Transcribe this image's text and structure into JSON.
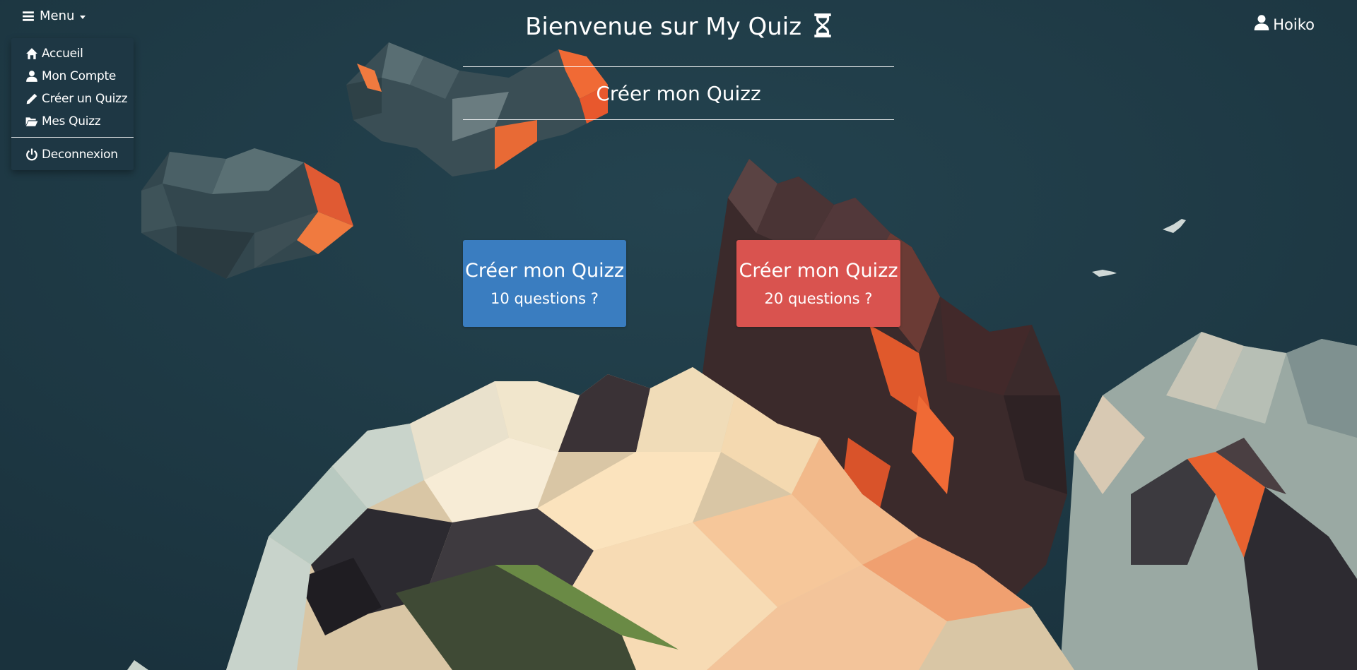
{
  "menu": {
    "toggle_label": "Menu",
    "items": [
      {
        "label": "Accueil",
        "icon": "home-icon"
      },
      {
        "label": "Mon Compte",
        "icon": "user-icon"
      },
      {
        "label": "Créer un Quizz",
        "icon": "pencil-icon"
      },
      {
        "label": "Mes Quizz",
        "icon": "folder-open-icon"
      }
    ],
    "logout": {
      "label": "Deconnexion",
      "icon": "power-icon"
    }
  },
  "user": {
    "name": "Hoiko",
    "icon": "user-icon"
  },
  "header": {
    "title": "Bienvenue sur My Quiz",
    "title_icon": "hourglass-icon",
    "section_title": "Créer mon Quizz"
  },
  "options": [
    {
      "title": "Créer mon Quizz",
      "subtitle": "10 questions ?",
      "color": "#3a7dc0"
    },
    {
      "title": "Créer mon Quizz",
      "subtitle": "20 questions ?",
      "color": "#d9534f"
    }
  ]
}
